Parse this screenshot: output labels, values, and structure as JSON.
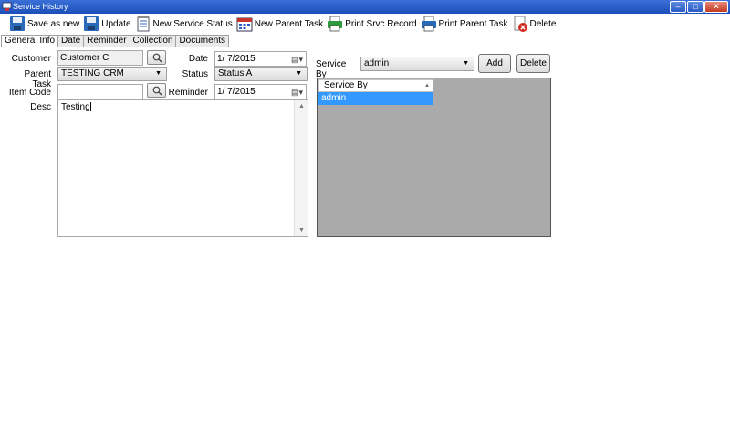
{
  "window": {
    "title": "Service History"
  },
  "toolbar": {
    "save_as_new": "Save as new",
    "update": "Update",
    "new_service_status": "New Service Status",
    "new_parent_task": "New Parent Task",
    "print_srvc_record": "Print Srvc Record",
    "print_parent_task": "Print Parent Task",
    "delete": "Delete"
  },
  "tabs": [
    "General Info",
    "Date",
    "Reminder",
    "Collection",
    "Documents"
  ],
  "form": {
    "customer_label": "Customer",
    "customer_value": "Customer C",
    "parent_task_label": "Parent Task",
    "parent_task_value": "TESTING CRM",
    "item_code_label": "Item Code",
    "item_code_value": "",
    "desc_label": "Desc",
    "desc_value": "Testing",
    "date_label": "Date",
    "date_value": "1/  7/2015",
    "status_label": "Status",
    "status_value": "Status A",
    "reminder_label": "Reminder",
    "reminder_value": "1/  7/2015"
  },
  "service_by": {
    "label": "Service By",
    "selected": "admin",
    "add_label": "Add",
    "delete_label": "Delete",
    "grid_header": "Service By",
    "rows": [
      "admin"
    ]
  }
}
